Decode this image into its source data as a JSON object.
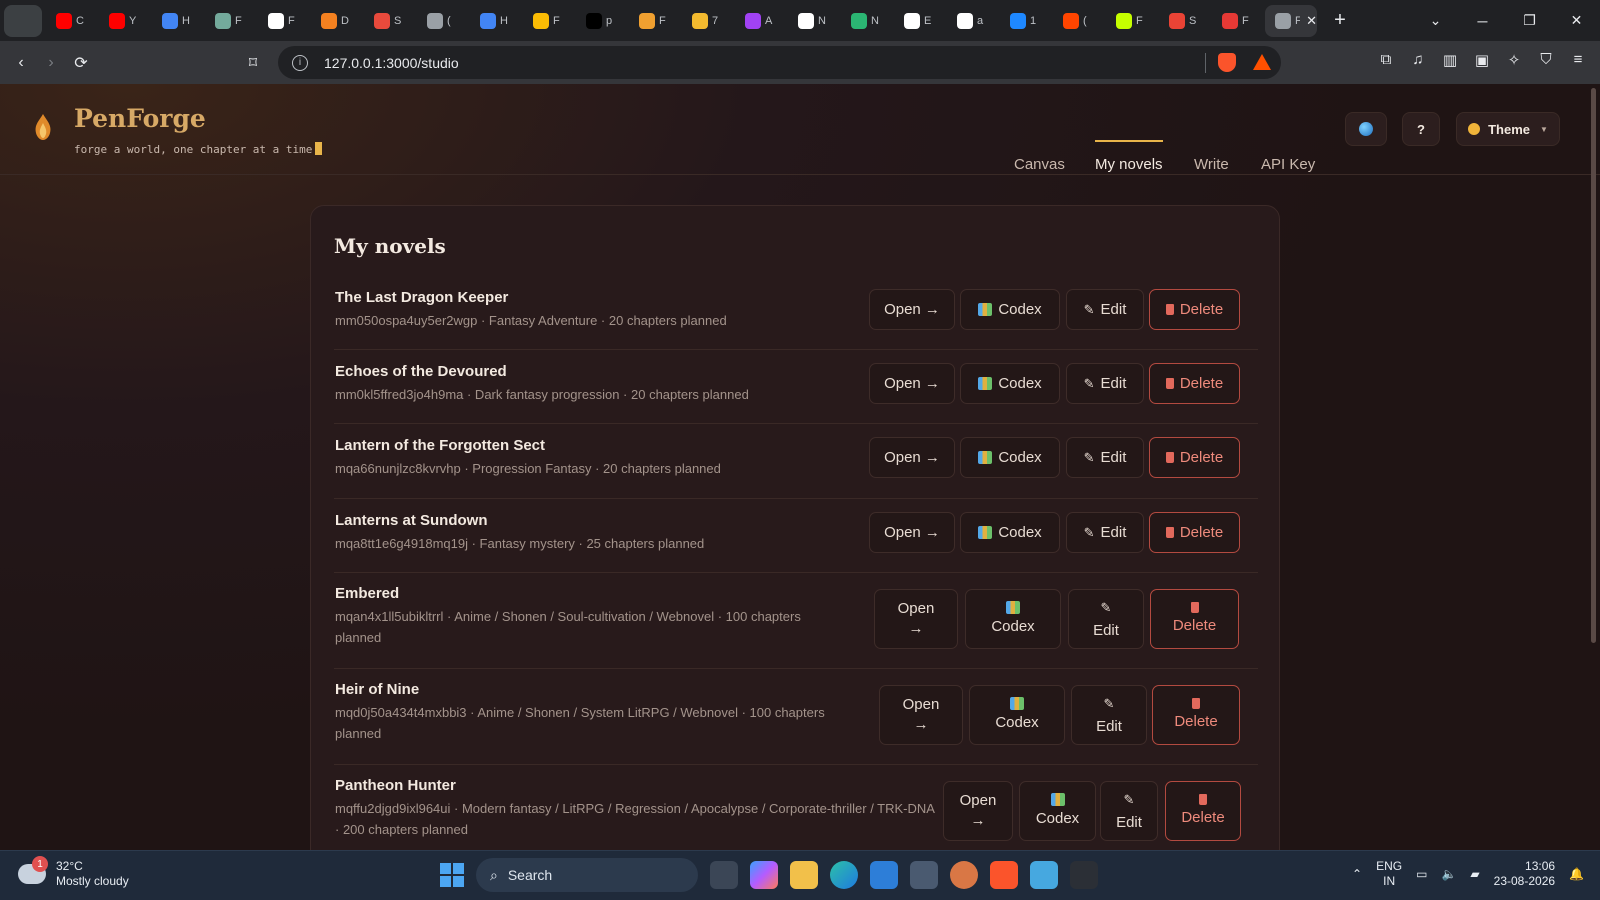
{
  "browser": {
    "tabs": [
      {
        "title": "C",
        "color": "#ff0000"
      },
      {
        "title": "Y",
        "color": "#ff0000"
      },
      {
        "title": "H",
        "color": "#4285f4"
      },
      {
        "title": "F",
        "color": "#74aa9c"
      },
      {
        "title": "F",
        "color": "#ffffff"
      },
      {
        "title": "D",
        "color": "#f48120"
      },
      {
        "title": "S",
        "color": "#e84a3c"
      },
      {
        "title": "(",
        "color": "#9aa0a6"
      },
      {
        "title": "H",
        "color": "#4285f4"
      },
      {
        "title": "F",
        "color": "#fbbc04"
      },
      {
        "title": "p",
        "color": "#000000"
      },
      {
        "title": "F",
        "color": "#f0a030"
      },
      {
        "title": "7",
        "color": "#f3ba2f"
      },
      {
        "title": "A",
        "color": "#a142f4"
      },
      {
        "title": "N",
        "color": "#ffffff"
      },
      {
        "title": "N",
        "color": "#2bb673"
      },
      {
        "title": "E",
        "color": "#ffffff"
      },
      {
        "title": "a",
        "color": "#ffffff"
      },
      {
        "title": "1",
        "color": "#1e88ff"
      },
      {
        "title": "(",
        "color": "#ff4500"
      },
      {
        "title": "F",
        "color": "#c6ff00"
      },
      {
        "title": "S",
        "color": "#ea4335"
      },
      {
        "title": "F",
        "color": "#e53935"
      },
      {
        "title": "F",
        "color": "#9aa0a6"
      }
    ],
    "url": "127.0.0.1:3000/studio"
  },
  "app": {
    "brand": "PenForge",
    "tagline": "forge a world, one chapter at a time",
    "nav": [
      "Canvas",
      "My novels",
      "Write",
      "API Key"
    ],
    "help_label": "?",
    "theme_label": "Theme",
    "accent": "#e8b44a"
  },
  "novels": {
    "heading": "My novels",
    "buttons": {
      "open": "Open →",
      "open_top": "Open",
      "open_bottom": "→",
      "codex": "Codex",
      "edit": "Edit",
      "delete": "Delete"
    },
    "items": [
      {
        "title": "The Last Dragon Keeper",
        "meta": "mm050ospa4uy5er2wgp · Fantasy Adventure · 20 chapters planned"
      },
      {
        "title": "Echoes of the Devoured",
        "meta": "mm0kl5ffred3jo4h9ma · Dark fantasy progression · 20 chapters planned"
      },
      {
        "title": "Lantern of the Forgotten Sect",
        "meta": "mqa66nunjlzc8kvrvhp · Progression Fantasy · 20 chapters planned"
      },
      {
        "title": "Lanterns at Sundown",
        "meta": "mqa8tt1e6g4918mq19j · Fantasy mystery · 25 chapters planned"
      },
      {
        "title": "Embered",
        "meta": "mqan4x1ll5ubikltrrl · Anime / Shonen / Soul-cultivation / Webnovel · 100 chapters planned"
      },
      {
        "title": "Heir of Nine",
        "meta": "mqd0j50a434t4mxbbi3 · Anime / Shonen / System LitRPG / Webnovel · 100 chapters planned"
      },
      {
        "title": "Pantheon Hunter",
        "meta": "mqffu2djgd9ixl964ui · Modern fantasy / LitRPG / Regression / Apocalypse / Corporate-thriller / TRK-DNA · 200 chapters planned"
      }
    ]
  },
  "taskbar": {
    "temp": "32°C",
    "weather": "Mostly cloudy",
    "badge": "1",
    "search": "Search",
    "lang1": "ENG",
    "lang2": "IN",
    "time": "13:06",
    "date": "23-08-2026"
  }
}
